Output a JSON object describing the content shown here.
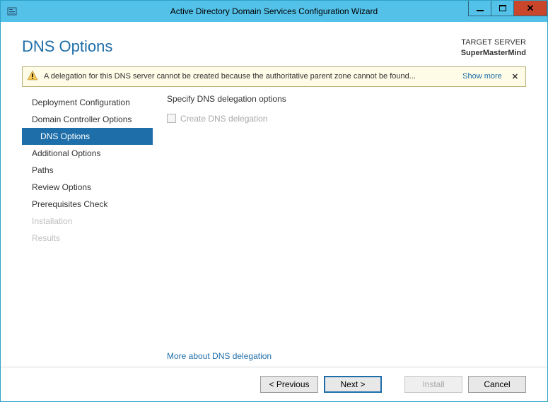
{
  "window": {
    "title": "Active Directory Domain Services Configuration Wizard"
  },
  "header": {
    "page_title": "DNS Options",
    "target_label": "TARGET SERVER",
    "target_value": "SuperMasterMind"
  },
  "alert": {
    "message": "A delegation for this DNS server cannot be created because the authoritative parent zone cannot be found...",
    "show_more": "Show more"
  },
  "sidebar": {
    "items": [
      {
        "label": "Deployment Configuration",
        "state": "normal"
      },
      {
        "label": "Domain Controller Options",
        "state": "normal"
      },
      {
        "label": "DNS Options",
        "state": "selected"
      },
      {
        "label": "Additional Options",
        "state": "normal"
      },
      {
        "label": "Paths",
        "state": "normal"
      },
      {
        "label": "Review Options",
        "state": "normal"
      },
      {
        "label": "Prerequisites Check",
        "state": "normal"
      },
      {
        "label": "Installation",
        "state": "disabled"
      },
      {
        "label": "Results",
        "state": "disabled"
      }
    ]
  },
  "content": {
    "heading": "Specify DNS delegation options",
    "checkbox_label": "Create DNS delegation",
    "more_link": "More about DNS delegation"
  },
  "footer": {
    "previous": "< Previous",
    "next": "Next >",
    "install": "Install",
    "cancel": "Cancel"
  }
}
